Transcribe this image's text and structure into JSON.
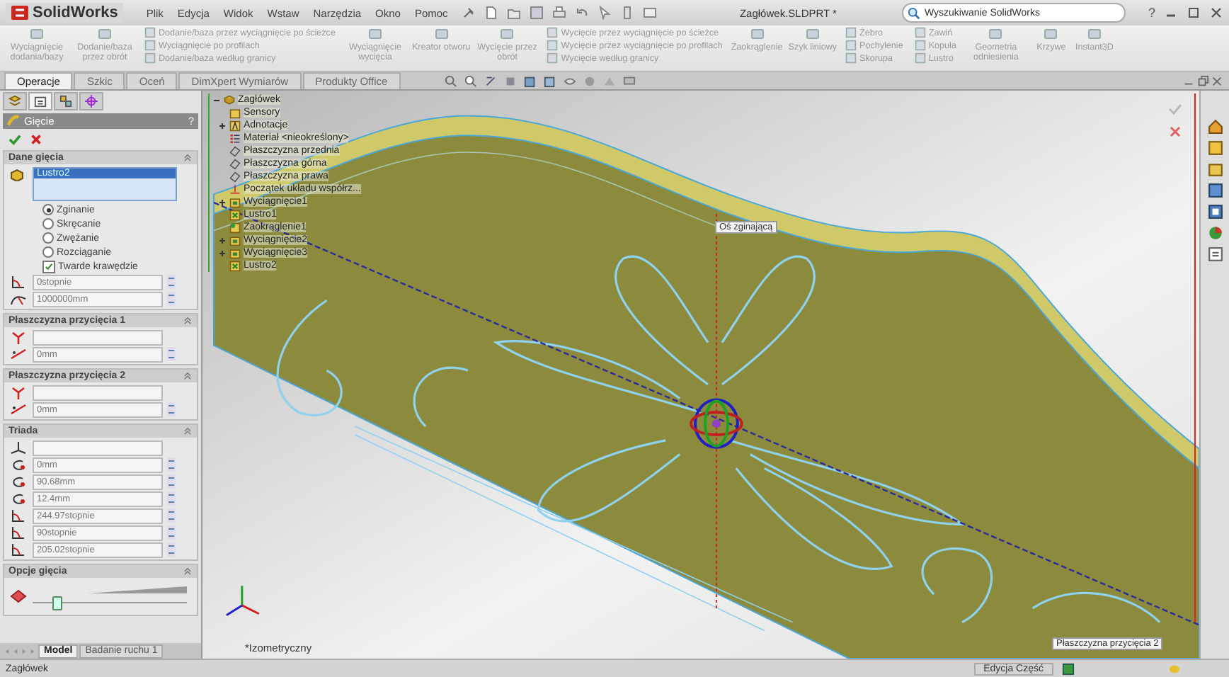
{
  "app": {
    "logo": "SolidWorks",
    "menu": [
      "Plik",
      "Edycja",
      "Widok",
      "Wstaw",
      "Narzędzia",
      "Okno",
      "Pomoc"
    ],
    "title": "Zagłówek.SLDPRT *",
    "search": {
      "placeholder": "Wyszukiwanie SolidWorks"
    },
    "help": "?"
  },
  "ribbon": {
    "disabled": true,
    "groups": [
      {
        "kind": "large",
        "label": "Wyciągnięcie dodania/bazy"
      },
      {
        "kind": "large",
        "label": "Dodanie/baza przez obrót"
      },
      {
        "kind": "stack",
        "items": [
          "Dodanie/baza przez wyciągnięcie po ścieżce",
          "Wyciągnięcie po profilach",
          "Dodanie/baza według granicy"
        ]
      },
      {
        "kind": "large",
        "label": "Wyciągnięcie wycięcia"
      },
      {
        "kind": "large",
        "label": "Kreator otworu"
      },
      {
        "kind": "large",
        "label": "Wycięcie przez obrót"
      },
      {
        "kind": "stack",
        "items": [
          "Wycięcie przez wyciągnięcie po ścieżce",
          "Wycięcie przez wyciągnięcie po profilach",
          "Wycięcie według granicy"
        ]
      },
      {
        "kind": "large",
        "label": "Zaokrąglenie"
      },
      {
        "kind": "large",
        "label": "Szyk liniowy"
      },
      {
        "kind": "stack",
        "items": [
          "Żebro",
          "Pochylenie",
          "Skorupa"
        ]
      },
      {
        "kind": "stack",
        "items": [
          "Zawiń",
          "Kopuła",
          "Lustro"
        ]
      },
      {
        "kind": "large",
        "label": "Geometria odniesienia"
      },
      {
        "kind": "large",
        "label": "Krzywe"
      },
      {
        "kind": "large",
        "label": "Instant3D"
      }
    ]
  },
  "command_tabs": [
    {
      "label": "Operacje",
      "selected": true
    },
    {
      "label": "Szkic",
      "selected": false
    },
    {
      "label": "Oceń",
      "selected": false
    },
    {
      "label": "DimXpert Wymiarów",
      "selected": false
    },
    {
      "label": "Produkty Office",
      "selected": false
    }
  ],
  "panel": {
    "tabs": [
      {
        "kind": "tree",
        "selected": false
      },
      {
        "kind": "property",
        "selected": true
      },
      {
        "kind": "config",
        "selected": false
      },
      {
        "kind": "dimxpert",
        "selected": false
      }
    ],
    "title": "Gięcie",
    "help": "?",
    "sections": [
      {
        "title": "Dane gięcia",
        "rows": [
          {
            "kind": "list",
            "items": [
              {
                "label": "Lustro2",
                "selected": true
              }
            ]
          },
          {
            "kind": "radio",
            "label": "Zginanie",
            "selected": true
          },
          {
            "kind": "radio",
            "label": "Skręcanie",
            "selected": false
          },
          {
            "kind": "radio",
            "label": "Zwężanie",
            "selected": false
          },
          {
            "kind": "radio",
            "label": "Rozciąganie",
            "selected": false
          },
          {
            "kind": "checkbox",
            "label": "Twarde krawędzie",
            "checked": true
          },
          {
            "kind": "angle",
            "value": "0stopnie"
          },
          {
            "kind": "radius",
            "value": "1000000mm"
          }
        ]
      },
      {
        "title": "Płaszczyzna przycięcia 1",
        "rows": [
          {
            "kind": "plane"
          },
          {
            "kind": "offset",
            "value": "0mm"
          }
        ]
      },
      {
        "title": "Płaszczyzna przycięcia 2",
        "rows": [
          {
            "kind": "plane"
          },
          {
            "kind": "offset",
            "value": "0mm"
          }
        ]
      },
      {
        "title": "Triada",
        "rows": [
          {
            "kind": "axes"
          },
          {
            "kind": "rotation",
            "value": "0mm"
          },
          {
            "kind": "rotation",
            "value": "90.68mm"
          },
          {
            "kind": "rotation",
            "value": "12.4mm"
          },
          {
            "kind": "angle",
            "value": "244.97stopnie"
          },
          {
            "kind": "angle",
            "value": "90stopnie"
          },
          {
            "kind": "angle",
            "value": "205.02stopnie"
          }
        ]
      },
      {
        "title": "Opcje gięcia",
        "rows": [
          {
            "kind": "slider",
            "level": 0.15
          }
        ]
      }
    ]
  },
  "viewport": {
    "tree": {
      "label": "Zagłówek",
      "expanded": true,
      "children": [
        {
          "label": "Sensory",
          "kind": "folder",
          "has_children": false
        },
        {
          "label": "Adnotacje",
          "kind": "annotation",
          "has_children": true
        },
        {
          "label": "Materiał <nieokreślony>",
          "kind": "material",
          "has_children": false
        },
        {
          "label": "Płaszczyzna przednia",
          "kind": "plane",
          "has_children": false
        },
        {
          "label": "Płaszczyzna górna",
          "kind": "plane",
          "has_children": false
        },
        {
          "label": "Płaszczyzna prawa",
          "kind": "plane",
          "has_children": false
        },
        {
          "label": "Początek układu współrz...",
          "kind": "origin",
          "has_children": false
        },
        {
          "label": "Wyciągnięcie1",
          "kind": "feature",
          "has_children": true
        },
        {
          "label": "Lustro1",
          "kind": "mirror",
          "has_children": false
        },
        {
          "label": "Zaokrąglenie1",
          "kind": "fillet",
          "has_children": false
        },
        {
          "label": "Wyciągnięcie2",
          "kind": "feature",
          "has_children": true
        },
        {
          "label": "Wyciągnięcie3",
          "kind": "feature",
          "has_children": true
        },
        {
          "label": "Lustro2",
          "kind": "mirror",
          "has_children": false
        }
      ]
    },
    "labels": [
      {
        "kind": "axis",
        "text": "Oś zginającą"
      },
      {
        "kind": "plane",
        "text": "Płaszczyzna przycięcia 2"
      }
    ],
    "view_name": "*Izometryczny"
  },
  "bottom_tabs": [
    {
      "label": "Model",
      "selected": true
    },
    {
      "label": "Badanie ruchu 1",
      "selected": false
    }
  ],
  "status_bar": {
    "file": "Zagłówek",
    "mode": "Edycja Część"
  }
}
